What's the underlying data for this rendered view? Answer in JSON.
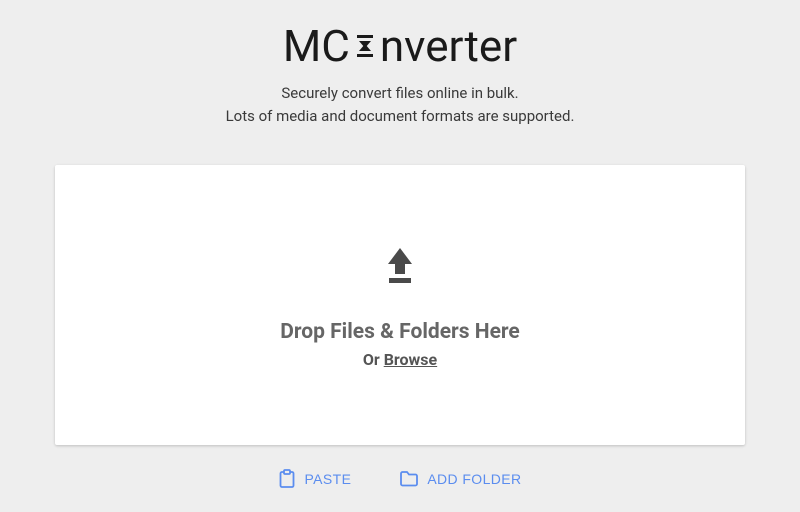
{
  "logo": {
    "prefix": "MC",
    "suffix": "nverter"
  },
  "tagline": {
    "line1": "Securely convert files online in bulk.",
    "line2": "Lots of media and document formats are supported."
  },
  "dropzone": {
    "main_text": "Drop Files & Folders Here",
    "or_label": "Or ",
    "browse_label": "Browse"
  },
  "actions": {
    "paste": "PASTE",
    "add_folder": "ADD FOLDER"
  }
}
